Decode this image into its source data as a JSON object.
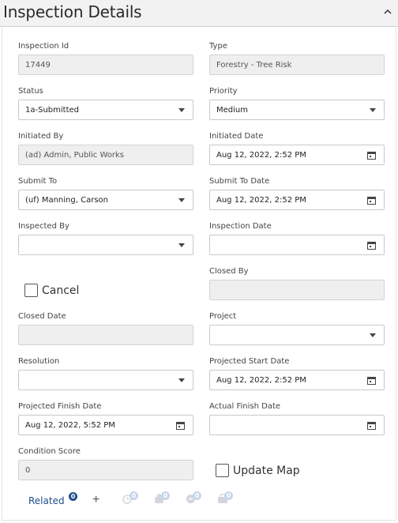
{
  "header": {
    "title": "Inspection Details"
  },
  "fields": {
    "inspection_id": {
      "label": "Inspection Id",
      "value": "17449"
    },
    "type": {
      "label": "Type",
      "value": "Forestry - Tree Risk"
    },
    "status": {
      "label": "Status",
      "value": "1a-Submitted"
    },
    "priority": {
      "label": "Priority",
      "value": "Medium"
    },
    "initiated_by": {
      "label": "Initiated By",
      "value": "(ad) Admin, Public Works"
    },
    "initiated_date": {
      "label": "Initiated Date",
      "value": "Aug 12, 2022, 2:52 PM"
    },
    "submit_to": {
      "label": "Submit To",
      "value": "(uf) Manning, Carson"
    },
    "submit_to_date": {
      "label": "Submit To Date",
      "value": "Aug 12, 2022, 2:52 PM"
    },
    "inspected_by": {
      "label": "Inspected By",
      "value": ""
    },
    "inspection_date": {
      "label": "Inspection Date",
      "value": ""
    },
    "cancel": {
      "label": "Cancel"
    },
    "closed_by": {
      "label": "Closed By",
      "value": ""
    },
    "closed_date": {
      "label": "Closed Date",
      "value": ""
    },
    "project": {
      "label": "Project",
      "value": ""
    },
    "resolution": {
      "label": "Resolution",
      "value": ""
    },
    "projected_start_date": {
      "label": "Projected Start Date",
      "value": "Aug 12, 2022, 2:52 PM"
    },
    "projected_finish_date": {
      "label": "Projected Finish Date",
      "value": "Aug 12, 2022, 5:52 PM"
    },
    "actual_finish_date": {
      "label": "Actual Finish Date",
      "value": ""
    },
    "condition_score": {
      "label": "Condition Score",
      "value": "0"
    },
    "update_map": {
      "label": "Update Map"
    }
  },
  "footer": {
    "related_label": "Related",
    "related_count": "0",
    "add_symbol": "+",
    "icon_counts": [
      "0",
      "0",
      "0",
      "0"
    ]
  },
  "colors": {
    "accent": "#1f4e8a",
    "badge_light": "#c5d6eb",
    "readonly_bg": "#efefef"
  }
}
